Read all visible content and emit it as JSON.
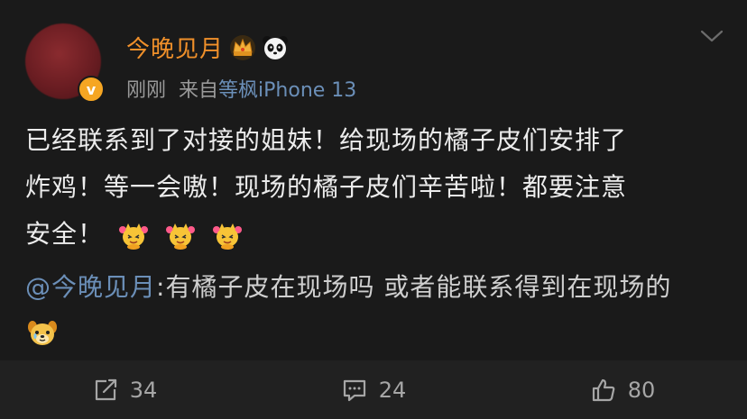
{
  "post": {
    "username": "今晚见月",
    "time": "刚刚",
    "source_prefix": "来自",
    "source_name": "等枫iPhone 13",
    "verified_mark": "v",
    "content": {
      "line1": "已经联系到了对接的姐妹！给现场的橘子皮们安排了",
      "line2": "炸鸡！等一会嗷！现场的橘子皮们辛苦啦！都要注意",
      "line3": "安全！"
    },
    "quote": {
      "mention": "@今晚见月",
      "text": ":有橘子皮在现场吗 或者能联系得到在现场的"
    }
  },
  "actions": {
    "repost_count": "34",
    "comment_count": "24",
    "like_count": "80"
  },
  "icons": {
    "badges": [
      "crown-icon",
      "panda-icon"
    ],
    "content_emoji": [
      "cheer-emoji-icon",
      "cheer-emoji-icon",
      "cheer-emoji-icon"
    ],
    "quote_emoji": "dog-emoji-icon",
    "menu": "chevron-down-icon",
    "actions": [
      "repost-icon",
      "comment-icon",
      "like-icon"
    ]
  },
  "colors": {
    "background": "#1a1a1a",
    "username": "#f0902a",
    "link": "#6b8fb8",
    "meta": "#9a9a9a",
    "verified": "#f6a623"
  }
}
